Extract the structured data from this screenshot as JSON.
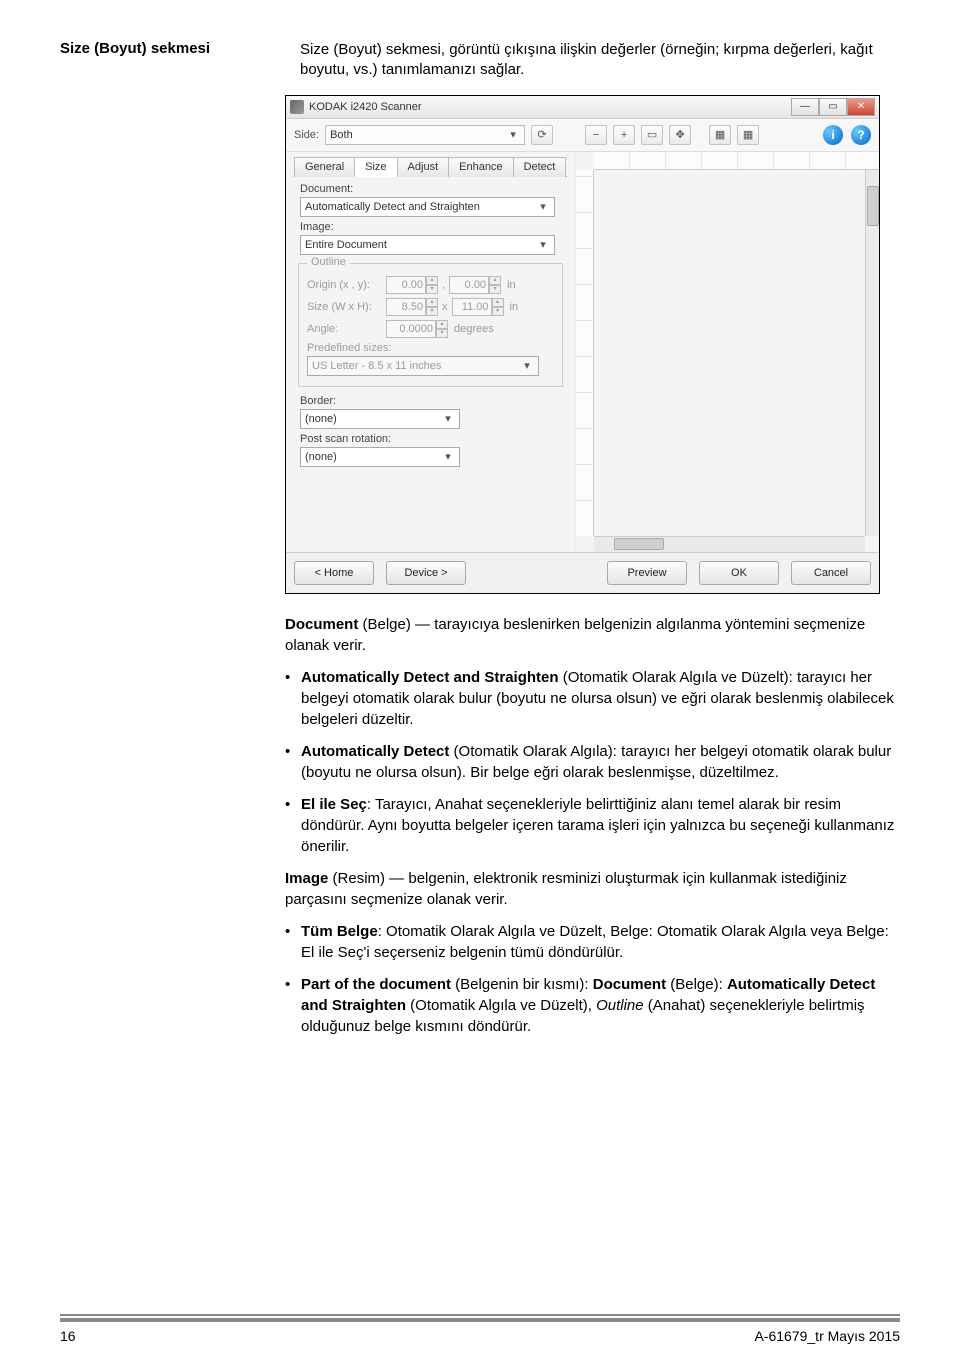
{
  "doc": {
    "sectionTitle": "Size (Boyut) sekmesi",
    "intro": "Size (Boyut) sekmesi, görüntü çıkışına ilişkin değerler (örneğin; kırpma değerleri, kağıt boyutu, vs.) tanımlamanızı sağlar.",
    "p1_lead": "Document",
    "p1_rest": " (Belge) — tarayıcıya beslenirken belgenizin algılanma yöntemini seçmenize olanak verir.",
    "li1_lead": "Automatically Detect and Straighten",
    "li1_rest": " (Otomatik Olarak Algıla ve Düzelt): tarayıcı her belgeyi otomatik olarak bulur (boyutu ne olursa olsun) ve eğri olarak beslenmiş olabilecek belgeleri düzeltir.",
    "li2_lead": "Automatically Detect",
    "li2_rest": " (Otomatik Olarak Algıla): tarayıcı her belgeyi otomatik olarak bulur (boyutu ne olursa olsun). Bir belge eğri olarak beslenmişse, düzeltilmez.",
    "li3_lead": "El ile Seç",
    "li3_rest": ": Tarayıcı, Anahat seçenekleriyle belirttiğiniz alanı temel alarak bir resim döndürür. Aynı boyutta belgeler içeren tarama işleri için yalnızca bu seçeneği kullanmanız önerilir.",
    "p2_lead": "Image",
    "p2_rest": " (Resim) — belgenin, elektronik resminizi oluşturmak için kullanmak istediğiniz parçasını seçmenize olanak verir.",
    "li4_lead": "Tüm Belge",
    "li4_rest": ": Otomatik Olarak Algıla ve Düzelt, Belge: Otomatik Olarak Algıla veya Belge: El ile Seç'i seçerseniz belgenin tümü döndürülür.",
    "li5_lead": "Part of the document",
    "li5_mid1": " (Belgenin bir kısmı): ",
    "li5_doc": "Document",
    "li5_mid2": " (Belge): ",
    "li5_auto": "Automatically Detect and Straighten",
    "li5_mid3": " (Otomatik Algıla ve Düzelt), ",
    "li5_outline": "Outline",
    "li5_rest": " (Anahat) seçenekleriyle belirtmiş olduğunuz belge kısmını döndürür.",
    "pageNum": "16",
    "footerRight": "A-61679_tr  Mayıs 2015"
  },
  "win": {
    "title": "KODAK i2420 Scanner",
    "sideLabel": "Side:",
    "sideValue": "Both",
    "tabs": [
      "General",
      "Size",
      "Adjust",
      "Enhance",
      "Detect"
    ],
    "activeTab": 1,
    "documentLabel": "Document:",
    "documentValue": "Automatically Detect and Straighten",
    "imageLabel": "Image:",
    "imageValue": "Entire Document",
    "outline": {
      "title": "Outline",
      "originLabel": "Origin (x , y):",
      "ox": "0.00",
      "oy": "0.00",
      "originUnit": "in",
      "sizeLabel": "Size (W x H):",
      "sw": "8.50",
      "sh": "11.00",
      "sizeUnit": "in",
      "angleLabel": "Angle:",
      "angle": "0.0000",
      "angleUnit": "degrees",
      "predefLabel": "Predefined sizes:",
      "predefValue": "US Letter - 8.5 x 11 inches"
    },
    "borderLabel": "Border:",
    "borderValue": "(none)",
    "postLabel": "Post scan rotation:",
    "postValue": "(none)",
    "buttons": {
      "home": "< Home",
      "device": "Device >",
      "preview": "Preview",
      "ok": "OK",
      "cancel": "Cancel"
    }
  }
}
